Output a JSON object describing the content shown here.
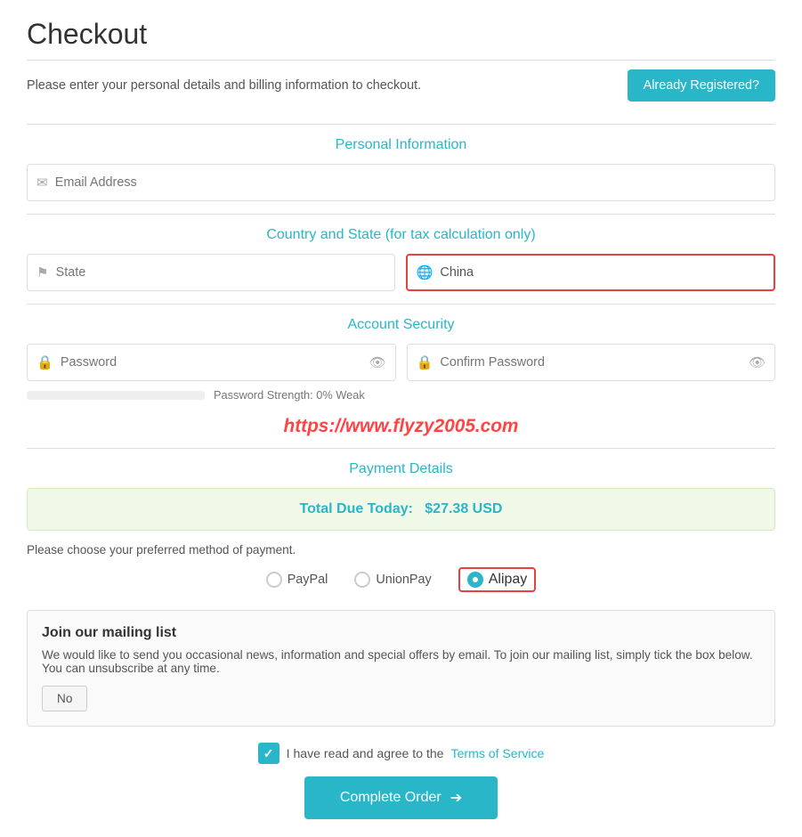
{
  "page": {
    "title": "Checkout",
    "subtitle": "Please enter your personal details and billing information to checkout.",
    "already_registered_label": "Already Registered?"
  },
  "personal_info": {
    "section_title": "Personal Information",
    "email_placeholder": "Email Address"
  },
  "country_state": {
    "section_title": "Country and State (for tax calculation only)",
    "state_placeholder": "State",
    "country_value": "China",
    "country_placeholder": "China"
  },
  "account_security": {
    "section_title": "Account Security",
    "password_placeholder": "Password",
    "confirm_password_placeholder": "Confirm Password",
    "strength_label": "Password Strength: 0% Weak"
  },
  "payment": {
    "section_title": "Payment Details",
    "total_label": "Total Due Today:",
    "total_value": "$27.38 USD",
    "payment_prompt": "Please choose your preferred method of payment.",
    "methods": [
      {
        "label": "PayPal",
        "selected": false
      },
      {
        "label": "UnionPay",
        "selected": false
      },
      {
        "label": "Alipay",
        "selected": true
      }
    ]
  },
  "mailing": {
    "title": "Join our mailing list",
    "description": "We would like to send you occasional news, information and special offers by email. To join our mailing list, simply tick the box below. You can unsubscribe at any time.",
    "button_label": "No"
  },
  "terms": {
    "pre_text": "I have read and agree to the",
    "link_text": "Terms of Service"
  },
  "complete_order": {
    "button_label": "Complete Order"
  },
  "watermark": {
    "text": "https://www.flyzy2005.com"
  },
  "icons": {
    "email": "✉",
    "flag": "⚑",
    "globe": "🌐",
    "lock": "🔒",
    "eye": "👁",
    "arrow_right": "➔",
    "checkmark": "✓"
  }
}
